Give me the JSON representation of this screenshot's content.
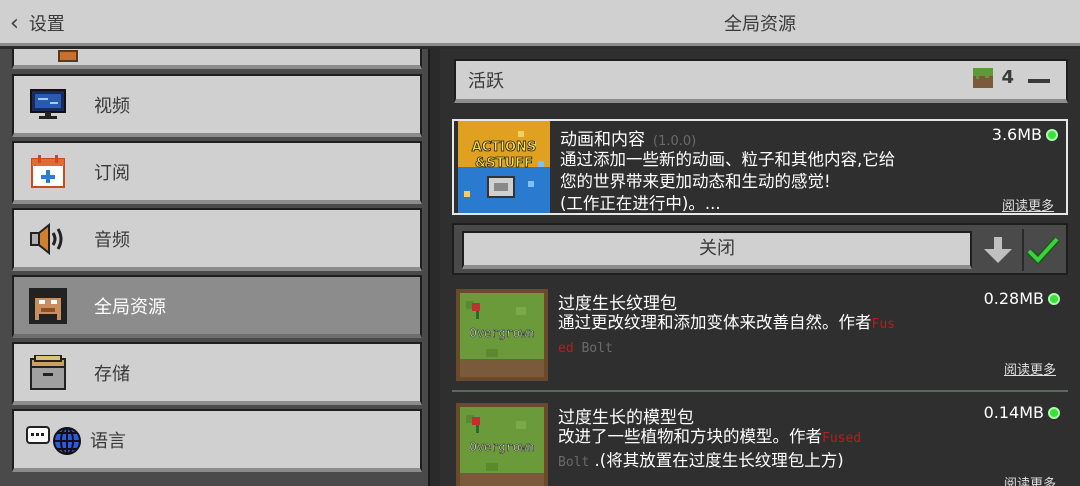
{
  "header": {
    "back_label": "设置",
    "title": "全局资源"
  },
  "sidebar": {
    "items": [
      {
        "label": "视频",
        "icon": "monitor-icon"
      },
      {
        "label": "订阅",
        "icon": "calendar-plus-icon"
      },
      {
        "label": "音频",
        "icon": "speaker-icon"
      },
      {
        "label": "全局资源",
        "icon": "resource-pack-icon",
        "active": true
      },
      {
        "label": "存储",
        "icon": "storage-box-icon"
      },
      {
        "label": "语言",
        "icon": "language-globe-icon"
      }
    ]
  },
  "main": {
    "active_label": "活跃",
    "active_count": "4",
    "packs": [
      {
        "name": "动画和内容",
        "version": "(1.0.0)",
        "desc": [
          "通过添加一些新的动画、粒子和其他内容,它给",
          "您的世界带来更加动态和生动的感觉!",
          "(工作正在进行中)。..."
        ],
        "size": "3.6MB",
        "readmore": "阅读更多",
        "thumb_text": [
          "ACTIONS",
          "&STUFF"
        ]
      },
      {
        "name": "过度生长纹理包",
        "desc_main": "通过更改纹理和添加变体来改善自然。作者",
        "author_red": "Fus",
        "author_red2": "ed",
        "author_gray": " Bolt",
        "size": "0.28MB",
        "readmore": "阅读更多",
        "thumb_text": "Overgrown"
      },
      {
        "name": "过度生长的模型包",
        "desc_main": "改进了一些植物和方块的模型。作者",
        "author_red": "Fused",
        "author_gray": "Bolt",
        "desc_tail": " .(将其放置在过度生长纹理包上方)",
        "size": "0.14MB",
        "readmore": "阅读更多",
        "thumb_text": "Overgrown"
      }
    ],
    "close_label": "关闭"
  },
  "colors": {
    "accent_green": "#3ce03c",
    "author_red": "#b81c1c",
    "panel_light": "#d0d0d0"
  }
}
